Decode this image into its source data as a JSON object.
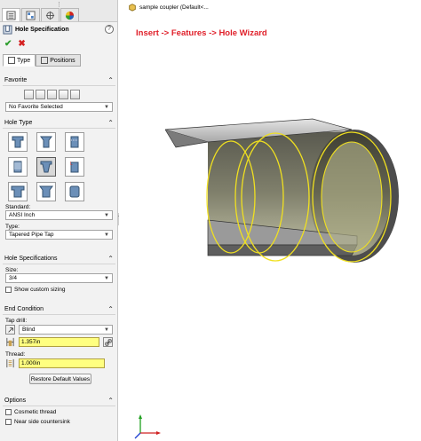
{
  "panel": {
    "title": "Hole Specification",
    "help": "?",
    "tabs": {
      "type": "Type",
      "positions": "Positions"
    },
    "favorite": {
      "header": "Favorite",
      "selected": "No Favorite Selected"
    },
    "hole_type": {
      "header": "Hole Type",
      "standard_label": "Standard:",
      "standard_value": "ANSI Inch",
      "type_label": "Type:",
      "type_value": "Tapered Pipe Tap"
    },
    "hole_spec": {
      "header": "Hole Specifications",
      "size_label": "Size:",
      "size_value": "3/4",
      "custom_sizing": "Show custom sizing"
    },
    "end_condition": {
      "header": "End Condition",
      "tap_drill_label": "Tap drill:",
      "tap_drill_condition": "Blind",
      "tap_drill_depth": "1.357in",
      "thread_label": "Thread:",
      "thread_depth": "1.000in",
      "restore_button": "Restore Default Values"
    },
    "options": {
      "header": "Options",
      "cosmetic_thread": "Cosmetic thread",
      "near_side_countersink": "Near side countersink"
    }
  },
  "graphics": {
    "tree_text": "sample coupler  (Default<...",
    "annotation": "Insert -> Features -> Hole Wizard",
    "colors": {
      "annotation": "#e0202a",
      "edge_highlight": "#f0e020",
      "body_top": "#c8c8c8",
      "body_side": "#909090",
      "body_dark": "#555555"
    }
  }
}
